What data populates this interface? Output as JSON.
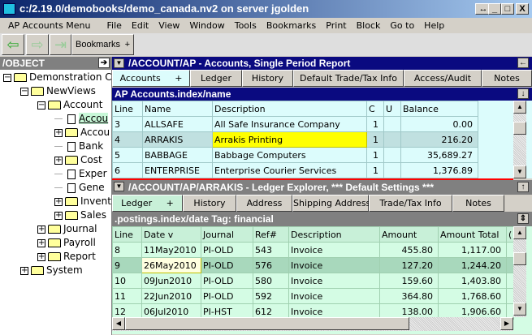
{
  "window": {
    "title": "c:/2.19.0/demobooks/demo_canada.nv2 on server jgolden",
    "resize": "↔",
    "min": "_",
    "max": "□",
    "close": "X"
  },
  "menu": [
    "AP Accounts Menu",
    "File",
    "Edit",
    "View",
    "Window",
    "Tools",
    "Bookmarks",
    "Print",
    "Block",
    "Go to",
    "Help"
  ],
  "toolbar": {
    "bookmarks": "Bookmarks",
    "plus": "+"
  },
  "tree": {
    "title": "/OBJECT",
    "items": [
      {
        "label": "Demonstration C",
        "type": "folder",
        "exp": "-",
        "lvl": 0
      },
      {
        "label": "NewViews",
        "type": "folder",
        "exp": "-",
        "lvl": 1
      },
      {
        "label": "Account",
        "type": "folder",
        "exp": "-",
        "lvl": 2
      },
      {
        "label": "Accou",
        "type": "doc",
        "exp": "",
        "lvl": 3
      },
      {
        "label": "Accou",
        "type": "folder",
        "exp": "+",
        "lvl": 3
      },
      {
        "label": "Bank",
        "type": "doc",
        "exp": "",
        "lvl": 3
      },
      {
        "label": "Cost",
        "type": "folder",
        "exp": "+",
        "lvl": 3
      },
      {
        "label": "Exper",
        "type": "doc",
        "exp": "",
        "lvl": 3
      },
      {
        "label": "Gene",
        "type": "doc",
        "exp": "",
        "lvl": 3
      },
      {
        "label": "Invent",
        "type": "folder",
        "exp": "+",
        "lvl": 3
      },
      {
        "label": "Sales",
        "type": "folder",
        "exp": "+",
        "lvl": 3
      },
      {
        "label": "Journal",
        "type": "folder",
        "exp": "+",
        "lvl": 2
      },
      {
        "label": "Payroll",
        "type": "folder",
        "exp": "+",
        "lvl": 2
      },
      {
        "label": "Report",
        "type": "folder",
        "exp": "+",
        "lvl": 2
      },
      {
        "label": "System",
        "type": "folder",
        "exp": "+",
        "lvl": 1
      }
    ]
  },
  "upper": {
    "title": "/ACCOUNT/AP - Accounts, Single Period Report",
    "tabs": [
      "Accounts     +",
      "Ledger",
      "History",
      "Default Trade/Tax Info",
      "Access/Audit",
      "Notes"
    ],
    "subtitle": "AP Accounts.index/name",
    "columns": [
      "Line",
      "Name",
      "Description",
      "C",
      "U",
      "Balance"
    ],
    "rows": [
      [
        "3",
        "ALLSAFE",
        "All Safe Insurance Company",
        "1",
        "",
        "0.00"
      ],
      [
        "4",
        "ARRAKIS",
        "Arrakis Printing",
        "1",
        "",
        "216.20"
      ],
      [
        "5",
        "BABBAGE",
        "Babbage Computers",
        "1",
        "",
        "35,689.27"
      ],
      [
        "6",
        "ENTERPRISE",
        "Enterprise Courier Services",
        "1",
        "",
        "1,376.89"
      ]
    ]
  },
  "lower": {
    "title": "/ACCOUNT/AP/ARRAKIS - Ledger Explorer, *** Default Settings ***",
    "tabs": [
      "Ledger     +",
      "History",
      "Address",
      "Shipping Address",
      "Trade/Tax Info",
      "Notes"
    ],
    "subtitle": ".postings.index/date  Tag: financial",
    "columns": [
      "Line",
      "Date  v",
      "Journal",
      "Ref#",
      "Description",
      "Amount",
      "Amount Total",
      "("
    ],
    "rows": [
      [
        "8",
        "11May2010",
        "PI-OLD",
        "543",
        "Invoice",
        "455.80",
        "1,117.00",
        ""
      ],
      [
        "9",
        "26May2010",
        "PI-OLD",
        "576",
        "Invoice",
        "127.20",
        "1,244.20",
        ""
      ],
      [
        "10",
        "09Jun2010",
        "PI-OLD",
        "580",
        "Invoice",
        "159.60",
        "1,403.80",
        ""
      ],
      [
        "11",
        "22Jun2010",
        "PI-OLD",
        "592",
        "Invoice",
        "364.80",
        "1,768.60",
        ""
      ],
      [
        "12",
        "06Jul2010",
        "PI-HST",
        "612",
        "Invoice",
        "138.00",
        "1,906.60",
        ""
      ]
    ]
  }
}
